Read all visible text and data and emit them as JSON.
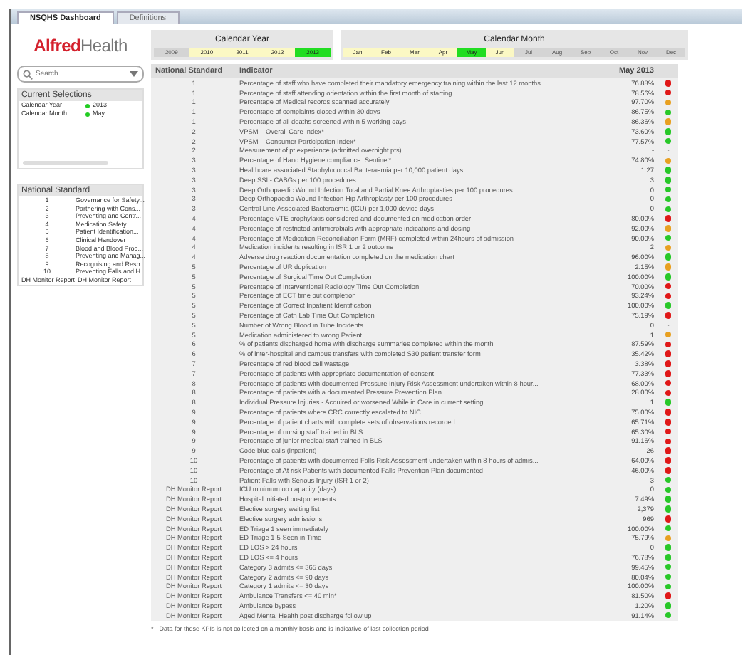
{
  "tabs": [
    {
      "label": "NSQHS Dashboard",
      "selected": true
    },
    {
      "label": "Definitions",
      "selected": false
    }
  ],
  "logo": {
    "primary": "Alfred",
    "secondary": "Health"
  },
  "search": {
    "placeholder": "Search"
  },
  "current_selections": {
    "title": "Current Selections",
    "items": [
      {
        "field": "Calendar Year",
        "value": "2013"
      },
      {
        "field": "Calendar Month",
        "value": "May"
      }
    ]
  },
  "national_standard_list": {
    "title": "National Standard",
    "items": [
      {
        "code": "1",
        "name": "Governance for Safety..."
      },
      {
        "code": "2",
        "name": "Partnering with Cons..."
      },
      {
        "code": "3",
        "name": "Preventing and Contr..."
      },
      {
        "code": "4",
        "name": "Medication Safety"
      },
      {
        "code": "5",
        "name": "Patient Identification..."
      },
      {
        "code": "6",
        "name": "Clinical Handover"
      },
      {
        "code": "7",
        "name": "Blood and Blood Prod..."
      },
      {
        "code": "8",
        "name": "Preventing and Manag..."
      },
      {
        "code": "9",
        "name": "Recognising and Resp..."
      },
      {
        "code": "10",
        "name": "Preventing Falls and H..."
      },
      {
        "code": "DH Monitor Report",
        "name": "DH Monitor Report"
      }
    ]
  },
  "calendar_year": {
    "title": "Calendar Year",
    "options": [
      {
        "label": "2009",
        "selected": false,
        "excluded": true
      },
      {
        "label": "2010",
        "selected": false,
        "excluded": false
      },
      {
        "label": "2011",
        "selected": false,
        "excluded": false
      },
      {
        "label": "2012",
        "selected": false,
        "excluded": false
      },
      {
        "label": "2013",
        "selected": true,
        "excluded": false
      }
    ]
  },
  "calendar_month": {
    "title": "Calendar Month",
    "options": [
      {
        "label": "Jan",
        "selected": false,
        "excluded": false
      },
      {
        "label": "Feb",
        "selected": false,
        "excluded": false
      },
      {
        "label": "Mar",
        "selected": false,
        "excluded": false
      },
      {
        "label": "Apr",
        "selected": false,
        "excluded": false
      },
      {
        "label": "May",
        "selected": true,
        "excluded": false
      },
      {
        "label": "Jun",
        "selected": false,
        "excluded": false
      },
      {
        "label": "Jul",
        "selected": false,
        "excluded": true
      },
      {
        "label": "Aug",
        "selected": false,
        "excluded": true
      },
      {
        "label": "Sep",
        "selected": false,
        "excluded": true
      },
      {
        "label": "Oct",
        "selected": false,
        "excluded": true
      },
      {
        "label": "Nov",
        "selected": false,
        "excluded": true
      },
      {
        "label": "Dec",
        "selected": false,
        "excluded": true
      }
    ]
  },
  "table": {
    "columns": [
      "National Standard",
      "Indicator",
      "May 2013"
    ],
    "rows": [
      {
        "standard": "1",
        "indicator": "Percentage of staff who have completed their mandatory emergency training within the last 12 months",
        "value": "76.88%",
        "color": "#e01818"
      },
      {
        "standard": "1",
        "indicator": "Percentage of staff attending orientation within the first month of starting",
        "value": "78.56%",
        "color": "#e01818"
      },
      {
        "standard": "1",
        "indicator": "Percentage of Medical records scanned accurately",
        "value": "97.70%",
        "color": "#e8a020"
      },
      {
        "standard": "1",
        "indicator": "Percentage of complaints closed within 30 days",
        "value": "86.75%",
        "color": "#28c828"
      },
      {
        "standard": "1",
        "indicator": "Percentage of all deaths screened within 5 working days",
        "value": "86.36%",
        "color": "#e8a020"
      },
      {
        "standard": "2",
        "indicator": "VPSM – Overall Care Index*",
        "value": "73.60%",
        "color": "#28c828"
      },
      {
        "standard": "2",
        "indicator": "VPSM – Consumer Participation Index*",
        "value": "77.57%",
        "color": "#28c828"
      },
      {
        "standard": "2",
        "indicator": "Measurement of pt experience (admitted overnight pts)",
        "value": "-",
        "marker": "-"
      },
      {
        "standard": "3",
        "indicator": "Percentage of Hand Hygiene compliance: Sentinel*",
        "value": "74.80%",
        "color": "#e8a020"
      },
      {
        "standard": "3",
        "indicator": "Healthcare associated Staphylococcal Bacteraemia per 10,000 patient days",
        "value": "1.27",
        "color": "#28c828"
      },
      {
        "standard": "3",
        "indicator": "Deep SSI - CABGs per 100 procedures",
        "value": "3",
        "color": "#28c828"
      },
      {
        "standard": "3",
        "indicator": "Deep Orthopaedic Wound Infection Total and Partial Knee Arthroplasties per 100 procedures",
        "value": "0",
        "color": "#28c828"
      },
      {
        "standard": "3",
        "indicator": "Deep Orthopaedic Wound Infection Hip Arthroplasty per 100 procedures",
        "value": "0",
        "color": "#28c828"
      },
      {
        "standard": "3",
        "indicator": "Central Line Associated Bacteraemia (ICU) per 1,000 device days",
        "value": "0",
        "color": "#28c828"
      },
      {
        "standard": "4",
        "indicator": "Percentage VTE prophylaxis considered and documented on medication order",
        "value": "80.00%",
        "color": "#e01818"
      },
      {
        "standard": "4",
        "indicator": "Percentage of restricted antimicrobials with appropriate indications and dosing",
        "value": "92.00%",
        "color": "#e8a020"
      },
      {
        "standard": "4",
        "indicator": "Percentage of Medication Reconciliation Form (MRF) completed within 24hours of admission",
        "value": "90.00%",
        "color": "#28c828"
      },
      {
        "standard": "4",
        "indicator": "Medication incidents resulting in ISR 1 or 2 outcome",
        "value": "2",
        "color": "#e8a020"
      },
      {
        "standard": "4",
        "indicator": "Adverse drug reaction documentation completed on the medication chart",
        "value": "96.00%",
        "color": "#28c828"
      },
      {
        "standard": "5",
        "indicator": "Percentage of UR duplication",
        "value": "2.15%",
        "color": "#e8a020"
      },
      {
        "standard": "5",
        "indicator": "Percentage of Surgical Time Out Completion",
        "value": "100.00%",
        "color": "#28c828"
      },
      {
        "standard": "5",
        "indicator": "Percentage of Interventional Radiology Time Out Completion",
        "value": "70.00%",
        "color": "#e01818"
      },
      {
        "standard": "5",
        "indicator": "Percentage of ECT time out completion",
        "value": "93.24%",
        "color": "#e01818"
      },
      {
        "standard": "5",
        "indicator": "Percentage of Correct Inpatient Identification",
        "value": "100.00%",
        "color": "#28c828"
      },
      {
        "standard": "5",
        "indicator": "Percentage of Cath Lab Time Out Completion",
        "value": "75.19%",
        "color": "#e01818"
      },
      {
        "standard": "5",
        "indicator": "Number of Wrong Blood in Tube Incidents",
        "value": "0",
        "marker": "-"
      },
      {
        "standard": "5",
        "indicator": "Medication administered to wrong Patient",
        "value": "1",
        "color": "#e8a020"
      },
      {
        "standard": "6",
        "indicator": "% of patients discharged home with discharge summaries completed within the month",
        "value": "87.59%",
        "color": "#e01818"
      },
      {
        "standard": "6",
        "indicator": "% of inter-hospital and campus transfers with completed S30 patient transfer form",
        "value": "35.42%",
        "color": "#e01818"
      },
      {
        "standard": "7",
        "indicator": "Percentage of red blood cell wastage",
        "value": "3.38%",
        "color": "#e01818"
      },
      {
        "standard": "7",
        "indicator": "Percentage of patients with appropriate documentation of consent",
        "value": "77.33%",
        "color": "#e01818"
      },
      {
        "standard": "8",
        "indicator": "Percentage of patients with documented Pressure Injury Risk Assessment undertaken within 8 hour...",
        "value": "68.00%",
        "color": "#e01818"
      },
      {
        "standard": "8",
        "indicator": "Percentage of patients with a documented Pressure Prevention Plan",
        "value": "28.00%",
        "color": "#e01818"
      },
      {
        "standard": "8",
        "indicator": "Individual Pressure Injuries - Acquired or worsened While in Care in current setting",
        "value": "1",
        "color": "#28c828"
      },
      {
        "standard": "9",
        "indicator": "Percentage of patients where CRC correctly escalated to NIC",
        "value": "75.00%",
        "color": "#e01818"
      },
      {
        "standard": "9",
        "indicator": "Percentage of patient charts with complete sets of observations recorded",
        "value": "65.71%",
        "color": "#e01818"
      },
      {
        "standard": "9",
        "indicator": "Percentage of nursing staff trained in BLS",
        "value": "65.30%",
        "color": "#e01818"
      },
      {
        "standard": "9",
        "indicator": "Percentage of junior medical staff trained in BLS",
        "value": "91.16%",
        "color": "#e01818"
      },
      {
        "standard": "9",
        "indicator": "Code blue calls (inpatient)",
        "value": "26",
        "color": "#e01818"
      },
      {
        "standard": "10",
        "indicator": "Percentage of patients with documented Falls Risk Assessment undertaken within 8 hours of admis...",
        "value": "64.00%",
        "color": "#e01818"
      },
      {
        "standard": "10",
        "indicator": "Percentage of At risk Patients with documented Falls Prevention Plan documented",
        "value": "46.00%",
        "color": "#e01818"
      },
      {
        "standard": "10",
        "indicator": "Patient Falls with Serious Injury (ISR 1 or 2)",
        "value": "3",
        "color": "#28c828"
      },
      {
        "standard": "DH Monitor Report",
        "indicator": "ICU minimum op capacity (days)",
        "value": "0",
        "color": "#28c828"
      },
      {
        "standard": "DH Monitor Report",
        "indicator": "Hospital initiated postponements",
        "value": "7.49%",
        "color": "#28c828"
      },
      {
        "standard": "DH Monitor Report",
        "indicator": "Elective surgery waiting list",
        "value": "2,379",
        "color": "#28c828"
      },
      {
        "standard": "DH Monitor Report",
        "indicator": "Elective surgery admissions",
        "value": "969",
        "color": "#e01818"
      },
      {
        "standard": "DH Monitor Report",
        "indicator": "ED Triage 1 seen immediately",
        "value": "100.00%",
        "color": "#28c828"
      },
      {
        "standard": "DH Monitor Report",
        "indicator": "ED Triage 1-5 Seen in Time",
        "value": "75.79%",
        "color": "#e8a020"
      },
      {
        "standard": "DH Monitor Report",
        "indicator": "ED LOS > 24 hours",
        "value": "0",
        "color": "#28c828"
      },
      {
        "standard": "DH Monitor Report",
        "indicator": "ED LOS <= 4 hours",
        "value": "76.78%",
        "color": "#28c828"
      },
      {
        "standard": "DH Monitor Report",
        "indicator": "Category 3 admits <= 365 days",
        "value": "99.45%",
        "color": "#28c828"
      },
      {
        "standard": "DH Monitor Report",
        "indicator": "Category 2 admits <= 90 days",
        "value": "80.04%",
        "color": "#28c828"
      },
      {
        "standard": "DH Monitor Report",
        "indicator": "Category 1 admits <= 30 days",
        "value": "100.00%",
        "color": "#28c828"
      },
      {
        "standard": "DH Monitor Report",
        "indicator": "Ambulance Transfers <= 40 min*",
        "value": "81.50%",
        "color": "#e01818"
      },
      {
        "standard": "DH Monitor Report",
        "indicator": "Ambulance bypass",
        "value": "1.20%",
        "color": "#28c828"
      },
      {
        "standard": "DH Monitor Report",
        "indicator": "Aged Mental Health post discharge follow up",
        "value": "91.14%",
        "color": "#28c828"
      }
    ]
  },
  "footnote": "* - Data for these KPIs is not collected on a monthly basis and is indicative of last collection period"
}
